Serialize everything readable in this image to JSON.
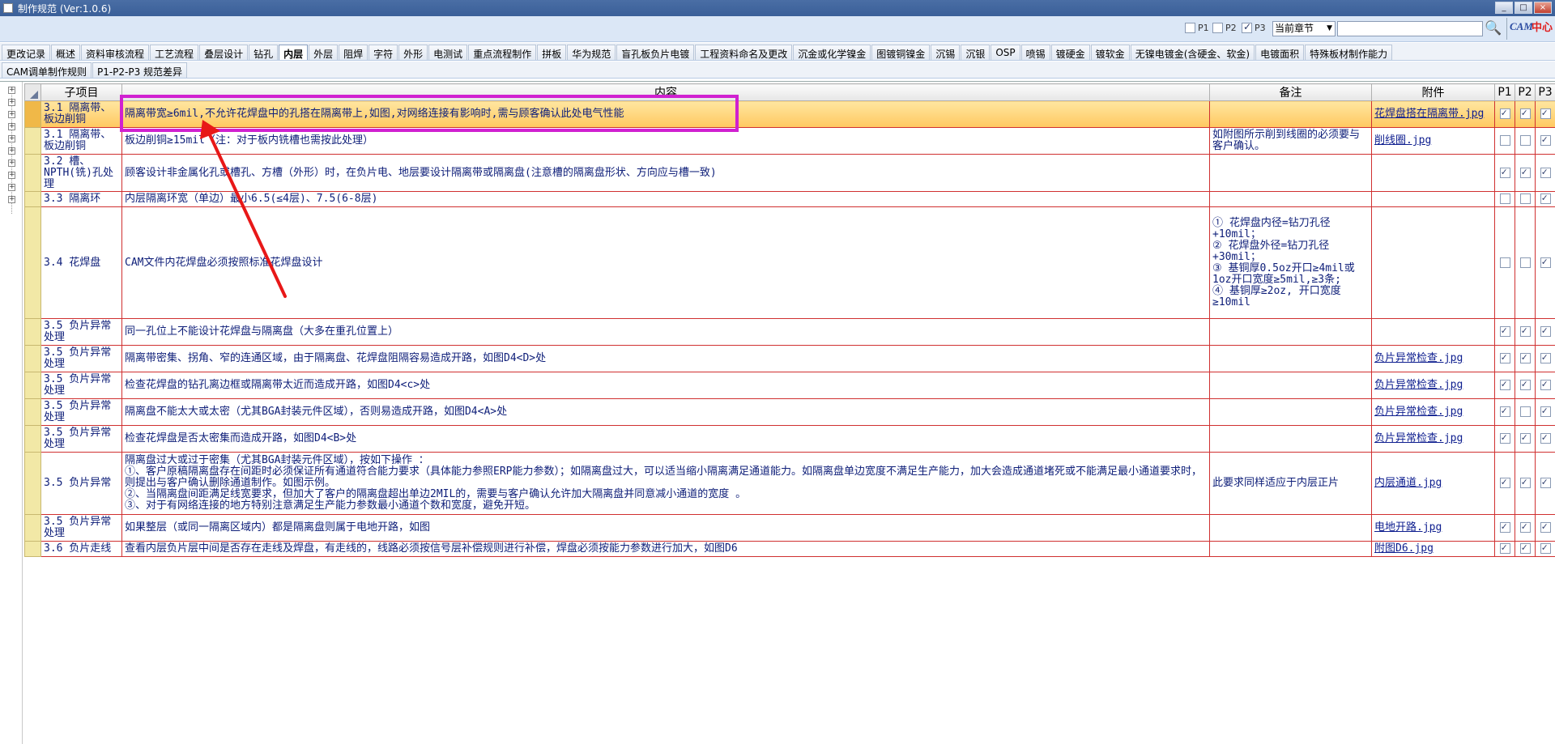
{
  "window": {
    "title": "制作规范 (Ver:1.0.6)",
    "buttons": [
      "_",
      "□",
      "×"
    ]
  },
  "toolbar": {
    "p1_label": "P1",
    "p2_label": "P2",
    "p3_label": "P3",
    "p1_checked": false,
    "p2_checked": false,
    "p3_checked": true,
    "chapter_select": "当前章节",
    "search_value": "",
    "logo_cam": "CAM",
    "logo_center": "中心"
  },
  "tabs_row1": [
    "更改记录",
    "概述",
    "资料审核流程",
    "工艺流程",
    "叠层设计",
    "钻孔",
    "内层",
    "外层",
    "阻焊",
    "字符",
    "外形",
    "电测试",
    "重点流程制作",
    "拼板",
    "华为规范",
    "盲孔板负片电镀",
    "工程资料命名及更改",
    "沉金或化学镍金",
    "图镀铜镍金",
    "沉锡",
    "沉银",
    "OSP",
    "喷锡",
    "镀硬金",
    "镀软金",
    "无镍电镀金(含硬金、软金)",
    "电镀面积",
    "特殊板材制作能力"
  ],
  "active_tab": "内层",
  "tabs_row2": [
    "CAM调单制作规则",
    "P1-P2-P3 规范差异"
  ],
  "table": {
    "headers": {
      "subitem": "子项目",
      "content": "内容",
      "remark": "备注",
      "attachment": "附件",
      "p1": "P1",
      "p2": "P2",
      "p3": "P3"
    },
    "rows": [
      {
        "sub": "3.1 隔离带、板边削铜",
        "content": "隔离带宽≥6mil,不允许花焊盘中的孔搭在隔离带上,如图,对网络连接有影响时,需与顾客确认此处电气性能",
        "remark": "",
        "att": "花焊盘搭在隔离带.jpg",
        "p1": true,
        "p2": true,
        "p3": true
      },
      {
        "sub": "3.1 隔离带、板边削铜",
        "content": "板边削铜≥15mil（注：对于板内铣槽也需按此处理）",
        "remark": "如附图所示削到线圈的必须要与客户确认。",
        "att": "削线圈.jpg",
        "p1": false,
        "p2": false,
        "p3": true
      },
      {
        "sub": "3.2 槽、NPTH(铣)孔处理",
        "content": "顾客设计非金属化孔或槽孔、方槽（外形）时，在负片电、地层要设计隔离带或隔离盘(注意槽的隔离盘形状、方向应与槽一致)",
        "remark": "",
        "att": "",
        "p1": true,
        "p2": true,
        "p3": true
      },
      {
        "sub": "3.3 隔离环",
        "content": "内层隔离环宽（单边）最小6.5(≤4层)、7.5(6-8层)",
        "remark": "",
        "att": "",
        "p1": false,
        "p2": false,
        "p3": true
      },
      {
        "sub": "3.4 花焊盘",
        "content": "CAM文件内花焊盘必须按照标准花焊盘设计",
        "remark": "① 花焊盘内径=钻刀孔径+10mil；\n② 花焊盘外径=钻刀孔径+30mil；\n③ 基铜厚0.5oz开口≥4mil或1oz开口宽度≥5mil,≥3条;\n④ 基铜厚≥2oz, 开口宽度≥10mil",
        "att": "",
        "p1": false,
        "p2": false,
        "p3": true
      },
      {
        "sub": "3.5 负片异常处理",
        "content": "同一孔位上不能设计花焊盘与隔离盘（大多在重孔位置上）",
        "remark": "",
        "att": "",
        "p1": true,
        "p2": true,
        "p3": true
      },
      {
        "sub": "3.5 负片异常处理",
        "content": "隔离带密集、拐角、窄的连通区域，由于隔离盘、花焊盘阻隔容易造成开路，如图D4<D>处",
        "remark": "",
        "att": "负片异常检查.jpg",
        "p1": true,
        "p2": true,
        "p3": true
      },
      {
        "sub": "3.5 负片异常处理",
        "content": "检查花焊盘的钻孔离边框或隔离带太近而造成开路，如图D4<c>处",
        "remark": "",
        "att": "负片异常检查.jpg",
        "p1": true,
        "p2": true,
        "p3": true
      },
      {
        "sub": "3.5 负片异常处理",
        "content": "隔离盘不能太大或太密（尤其BGA封装元件区域），否则易造成开路，如图D4<A>处",
        "remark": "",
        "att": "负片异常检查.jpg",
        "p1": true,
        "p2": false,
        "p3": true
      },
      {
        "sub": "3.5 负片异常处理",
        "content": "检查花焊盘是否太密集而造成开路，如图D4<B>处",
        "remark": "",
        "att": "负片异常检查.jpg",
        "p1": true,
        "p2": true,
        "p3": true
      },
      {
        "sub": "3.5 负片异常",
        "content": "隔离盘过大或过于密集（尤其BGA封装元件区域），按如下操作 ：\n①、客户原稿隔离盘存在间距时必须保证所有通道符合能力要求（具体能力参照ERP能力参数）；如隔离盘过大，可以适当缩小隔离满足通道能力。如隔离盘单边宽度不满足生产能力，加大会造成通道堵死或不能满足最小通道要求时，则提出与客户确认删除通道制作。如图示例。\n②、当隔离盘间距满足线宽要求，但加大了客户的隔离盘超出单边2MIL的，需要与客户确认允许加大隔离盘并同意减小通道的宽度 。\n③、对于有网络连接的地方特别注意满足生产能力参数最小通道个数和宽度，避免开短。",
        "remark": "此要求同样适应于内层正片",
        "att": "内层通道.jpg",
        "p1": true,
        "p2": true,
        "p3": true
      },
      {
        "sub": "3.5 负片异常处理",
        "content": "如果整层（或同一隔离区域内）都是隔离盘则属于电地开路，如图",
        "remark": "",
        "att": "电地开路.jpg",
        "p1": true,
        "p2": true,
        "p3": true
      },
      {
        "sub": "3.6 负片走线",
        "content": "查看内层负片层中间是否存在走线及焊盘，有走线的，线路必须按信号层补偿规则进行补偿，焊盘必须按能力参数进行加大，如图D6",
        "remark": "",
        "att": "附图D6.jpg",
        "p1": true,
        "p2": true,
        "p3": true
      }
    ]
  },
  "colors": {
    "highlight": "#d020d0",
    "arrow": "#e81818",
    "cell_border": "#d03030",
    "text": "#10207a"
  },
  "annotation": {
    "type": "magenta-box-and-red-arrow",
    "target_row": 0
  }
}
